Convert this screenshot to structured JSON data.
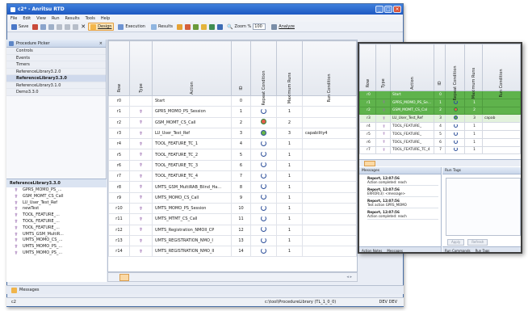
{
  "window": {
    "title": "c2* - Anritsu RTD"
  },
  "menu": [
    "File",
    "Edit",
    "View",
    "Run",
    "Results",
    "Tools",
    "Help"
  ],
  "toolbar": {
    "save_label": "Save",
    "design_label": "Design",
    "execution_label": "Execution",
    "results_label": "Results",
    "zoom_label": "Zoom %",
    "zoom_value": "100",
    "analyze_label": "Analyze"
  },
  "procedure_picker": {
    "title": "Procedure Picker",
    "items": [
      "Controls",
      "Events",
      "Timers",
      "ReferenceLibrary3.2.0",
      "ReferenceLibrary3.3.0",
      "ReferenceLibrary3.1.0",
      "Demo3.3.0"
    ]
  },
  "library_tree": {
    "title": "ReferenceLibrary3.3.0",
    "items": [
      "GPRS_MOMO_PS_...",
      "GSM_MOMT_CS_Call",
      "LU_User_Test_Ref",
      "newTest",
      "TOOL_FEATURE_...",
      "TOOL_FEATURE_...",
      "TOOL_FEATURE_...",
      "UMTS_GSM_MultiR...",
      "UMTS_MOMO_CS_...",
      "UMTS_MOMO_PS_...",
      "UMTS_MOMO_PS_..."
    ]
  },
  "table": {
    "headers": [
      "Row",
      "Type",
      "Action",
      "ID",
      "Repeat Condition",
      "Maximum Runs",
      "Run Condition"
    ],
    "rows": [
      {
        "row": "r0",
        "action": "Start",
        "id": "0",
        "rep": "",
        "max": "",
        "cond": ""
      },
      {
        "row": "r1",
        "action": "GPRS_MOMO_PS_Session",
        "id": "1",
        "rep": "blue",
        "max": "1",
        "cond": ""
      },
      {
        "row": "r2",
        "action": "GSM_MOMT_CS_Call",
        "id": "2",
        "rep": "red",
        "max": "2",
        "cond": ""
      },
      {
        "row": "r3",
        "action": "LU_User_Test_Ref",
        "id": "3",
        "rep": "green",
        "max": "3",
        "cond": "capability4"
      },
      {
        "row": "r4",
        "action": "TOOL_FEATURE_TC_1",
        "id": "4",
        "rep": "blue",
        "max": "1",
        "cond": ""
      },
      {
        "row": "r5",
        "action": "TOOL_FEATURE_TC_2",
        "id": "5",
        "rep": "blue",
        "max": "1",
        "cond": ""
      },
      {
        "row": "r6",
        "action": "TOOL_FEATURE_TC_3",
        "id": "6",
        "rep": "blue",
        "max": "1",
        "cond": ""
      },
      {
        "row": "r7",
        "action": "TOOL_FEATURE_TC_4",
        "id": "7",
        "rep": "blue",
        "max": "1",
        "cond": ""
      },
      {
        "row": "r8",
        "action": "UMTS_GSM_MultiRAB_Blind_Ha...",
        "id": "8",
        "rep": "blue",
        "max": "1",
        "cond": ""
      },
      {
        "row": "r9",
        "action": "UMTS_MOMO_CS_Call",
        "id": "9",
        "rep": "blue",
        "max": "1",
        "cond": ""
      },
      {
        "row": "r10",
        "action": "UMTS_MOMO_PS_Session",
        "id": "10",
        "rep": "blue",
        "max": "1",
        "cond": ""
      },
      {
        "row": "r11",
        "action": "UMTS_MTMT_CS_Call",
        "id": "11",
        "rep": "blue",
        "max": "1",
        "cond": ""
      },
      {
        "row": "r12",
        "action": "UMTS_Registration_NMOII_CP",
        "id": "12",
        "rep": "blue",
        "max": "1",
        "cond": ""
      },
      {
        "row": "r13",
        "action": "UMTS_REGISTRATION_NMO_I",
        "id": "13",
        "rep": "blue",
        "max": "1",
        "cond": ""
      },
      {
        "row": "r14",
        "action": "UMTS_REGISTRATION_NMO_II",
        "id": "14",
        "rep": "blue",
        "max": "1",
        "cond": ""
      }
    ]
  },
  "inset": {
    "headers": [
      "Row",
      "Type",
      "Action",
      "ID",
      "Repeat Condition",
      "Maximum Runs",
      "Run Condition"
    ],
    "rows": [
      {
        "row": "r0",
        "action": "Start",
        "id": "0",
        "max": "",
        "cond": "",
        "hl": "g"
      },
      {
        "row": "r1",
        "action": "GPRS_MOMO_PS_Se...",
        "id": "1",
        "max": "1",
        "cond": "",
        "hl": "g"
      },
      {
        "row": "r2",
        "action": "GSM_MOMT_CS_Cal",
        "id": "2",
        "max": "2",
        "cond": "",
        "hl": "g"
      },
      {
        "row": "r3",
        "action": "LU_User_Test_Ref",
        "id": "3",
        "max": "3",
        "cond": "capab",
        "hl": ""
      },
      {
        "row": "r4",
        "action": "TOOL_FEATURE_",
        "id": "4",
        "max": "1",
        "cond": "",
        "hl": ""
      },
      {
        "row": "r5",
        "action": "TOOL_FEATURE_",
        "id": "5",
        "max": "1",
        "cond": "",
        "hl": ""
      },
      {
        "row": "r6",
        "action": "TOOL_FEATURE_",
        "id": "6",
        "max": "1",
        "cond": "",
        "hl": ""
      },
      {
        "row": "r7",
        "action": "TOOL_FEATURE_TC_4",
        "id": "7",
        "max": "1",
        "cond": "",
        "hl": ""
      }
    ],
    "messages_title": "Messages",
    "messages": [
      {
        "head": "Report, 12:07:56",
        "lines": [
          "Action completed: reach"
        ]
      },
      {
        "head": "Report, 12:07:56",
        "lines": [
          "ERROR(3): <message>"
        ]
      },
      {
        "head": "Report, 12:07:56",
        "lines": [
          "Test action GPRS_MOMO"
        ]
      },
      {
        "head": "Report, 12:07:56",
        "lines": [
          "Action completed: reach"
        ]
      }
    ],
    "run_tags_title": "Run Tags",
    "apply_label": "Apply",
    "refresh_label": "Refresh",
    "foot_left": [
      "Action Notes",
      "Messages"
    ],
    "foot_right": [
      "Run Commands",
      "Run Tags"
    ]
  },
  "bottom_tab": {
    "messages_label": "Messages"
  },
  "status": {
    "left": "c2",
    "path": "c:\\tool\\ProcedureLibrary (TL_1_0_0)",
    "device": "DEV DEV"
  }
}
